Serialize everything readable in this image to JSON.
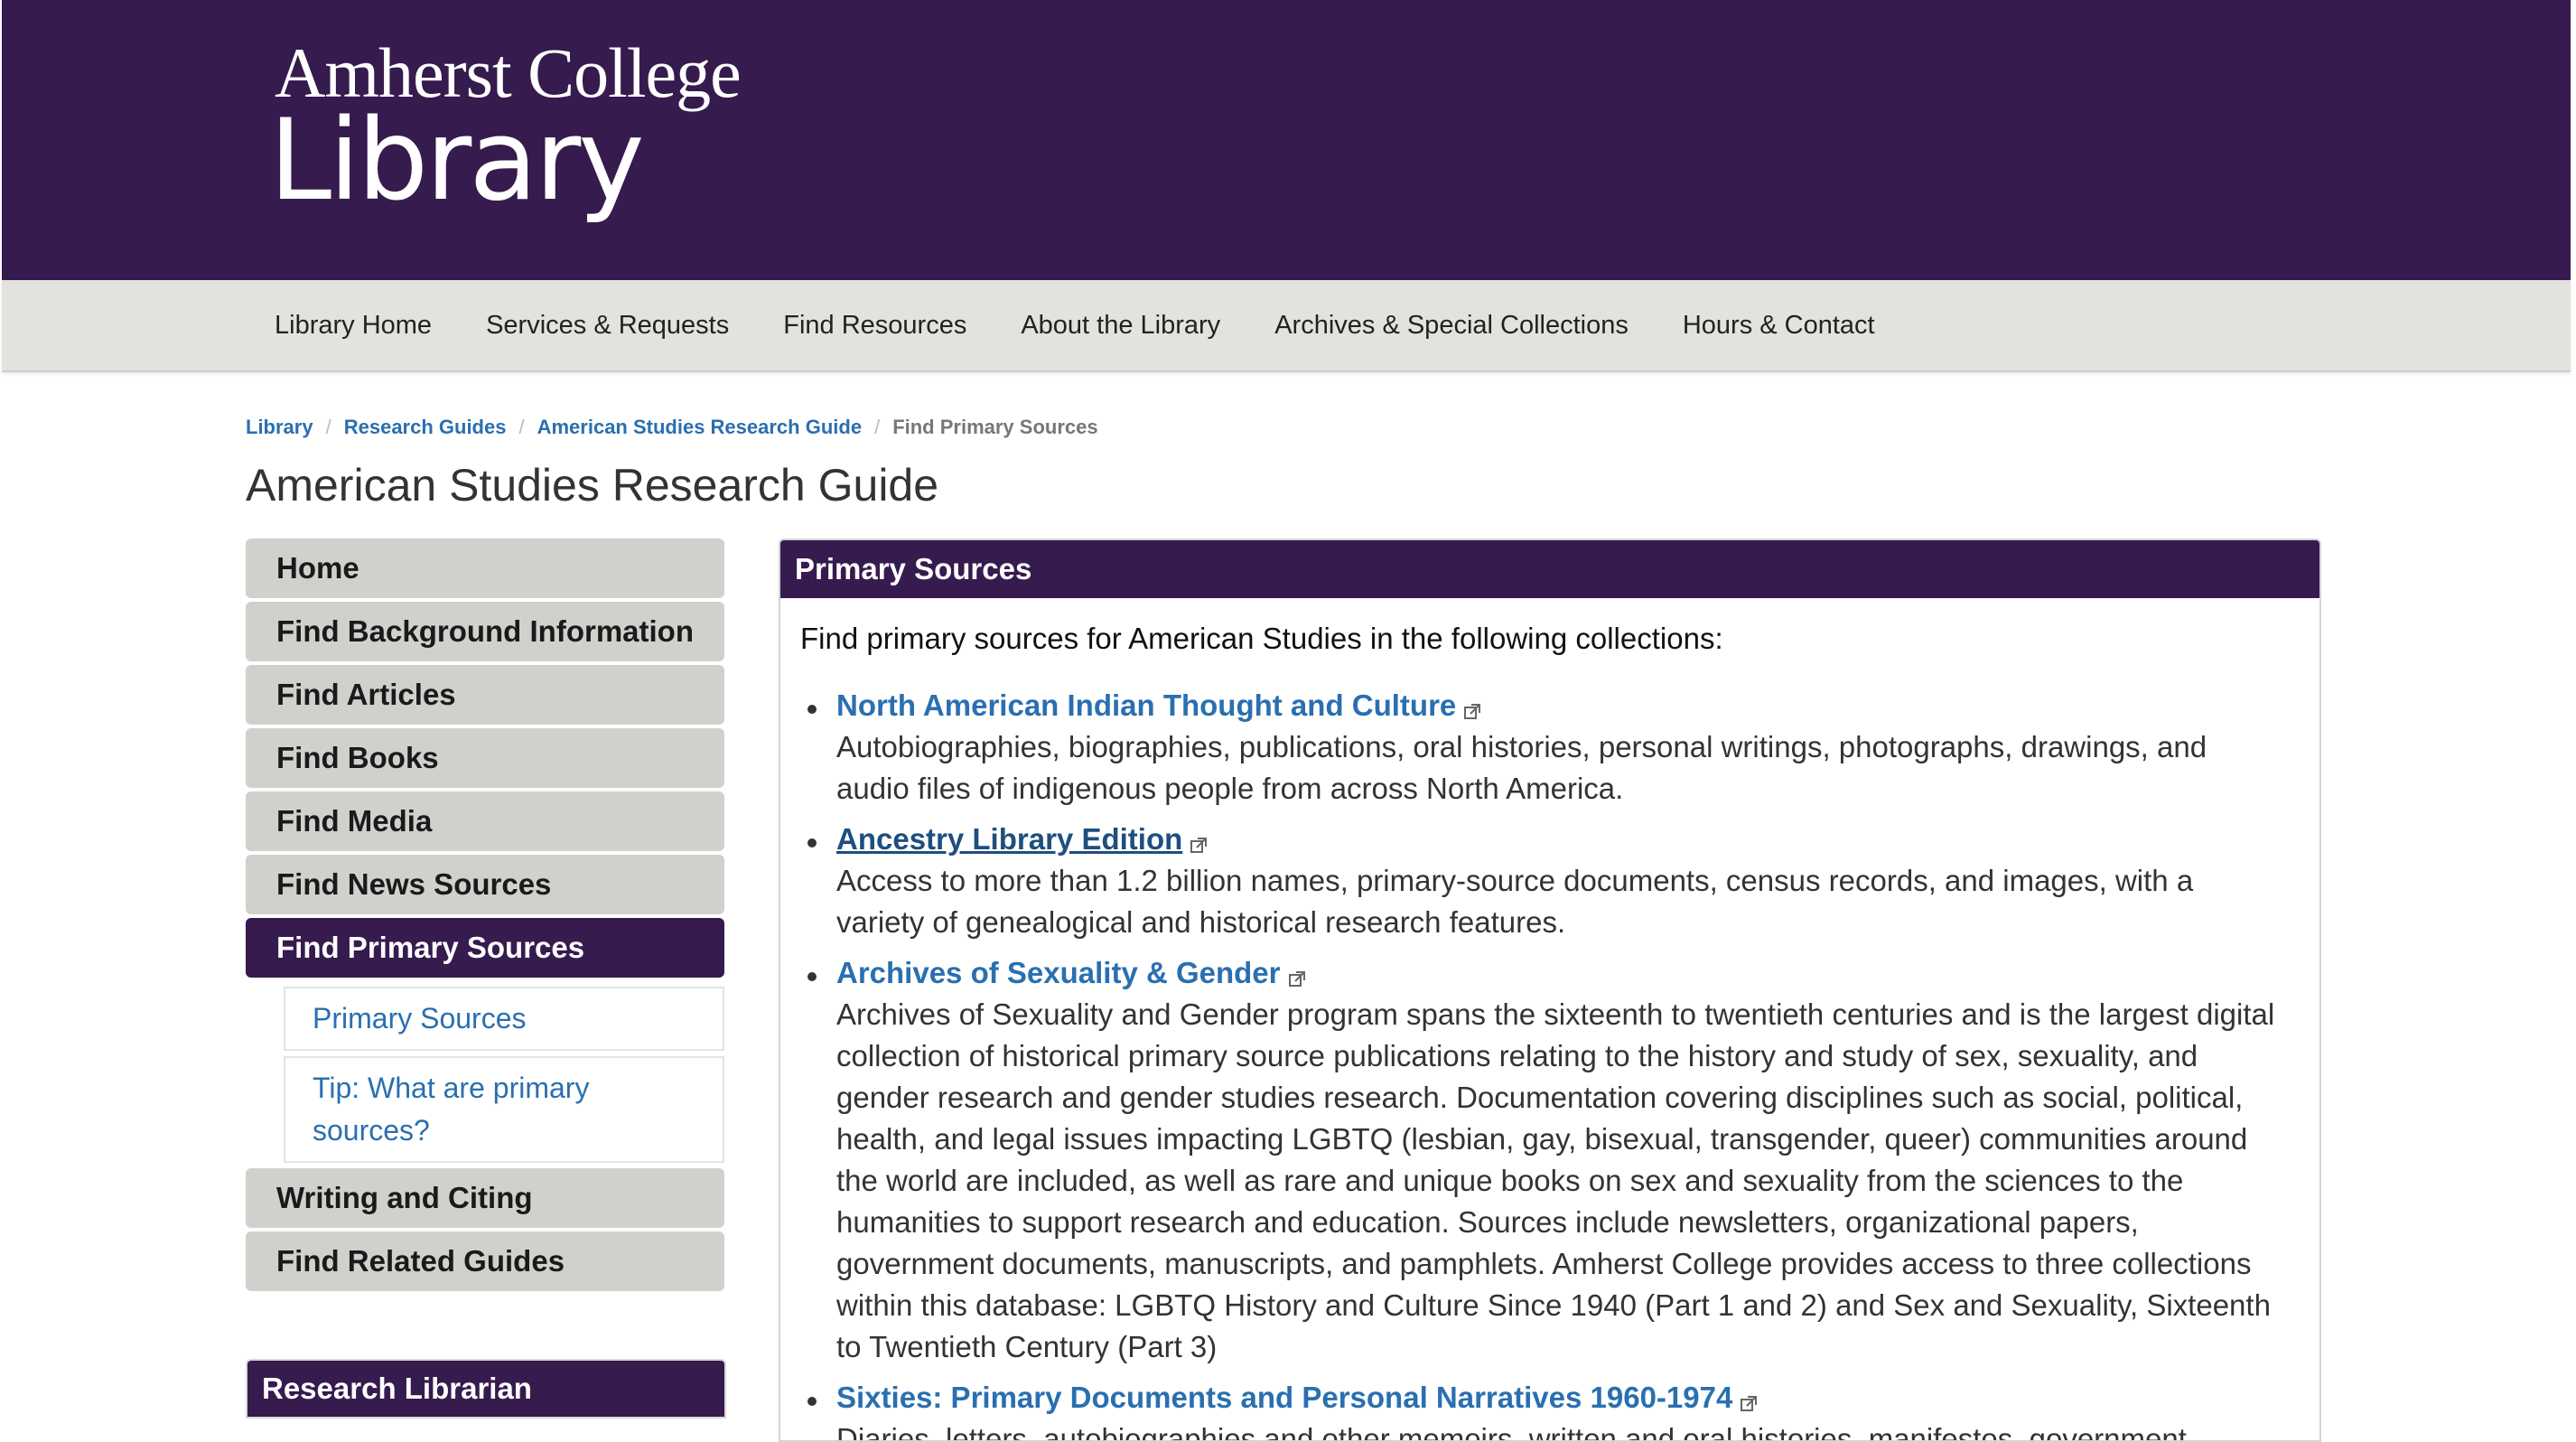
{
  "header": {
    "logo_line1": "Amherst College",
    "logo_line2": "Library"
  },
  "nav": {
    "items": [
      {
        "label": "Library Home"
      },
      {
        "label": "Services & Requests"
      },
      {
        "label": "Find Resources"
      },
      {
        "label": "About the Library"
      },
      {
        "label": "Archives & Special Collections"
      },
      {
        "label": "Hours & Contact"
      }
    ]
  },
  "breadcrumb": {
    "items": [
      {
        "label": "Library"
      },
      {
        "label": "Research Guides"
      },
      {
        "label": "American Studies Research Guide"
      }
    ],
    "current": "Find Primary Sources"
  },
  "page": {
    "title": "American Studies Research Guide"
  },
  "sidebar": {
    "items": [
      {
        "label": "Home"
      },
      {
        "label": "Find Background Information"
      },
      {
        "label": "Find Articles"
      },
      {
        "label": "Find Books"
      },
      {
        "label": "Find Media"
      },
      {
        "label": "Find News Sources"
      },
      {
        "label": "Find Primary Sources"
      },
      {
        "label": "Writing and Citing"
      },
      {
        "label": "Find Related Guides"
      }
    ],
    "subitems": [
      {
        "label": "Primary Sources"
      },
      {
        "label": "Tip: What are primary sources?"
      }
    ],
    "librarian_title": "Research Librarian"
  },
  "main": {
    "panel_title": "Primary Sources",
    "intro": "Find primary sources for American Studies in the following collections:",
    "resources": [
      {
        "title": "North American Indian Thought and Culture",
        "description": "Autobiographies, biographies, publications, oral histories, personal writings, photographs, drawings, and audio files of indigenous people from across North America."
      },
      {
        "title": "Ancestry Library Edition",
        "description": "Access to more than 1.2 billion names, primary-source documents, census records, and images, with a variety of genealogical and historical research features."
      },
      {
        "title": "Archives of Sexuality & Gender",
        "description": "Archives of Sexuality and Gender program spans the sixteenth to twentieth centuries and is the largest digital collection of historical primary source publications relating to the history and study of sex, sexuality, and gender research and gender studies research. Documentation covering disciplines such as social, political, health, and legal issues impacting LGBTQ (lesbian, gay, bisexual, transgender, queer) communities around the world are included, as well as rare and unique books on sex and sexuality from the sciences to the humanities to support research and education. Sources include newsletters, organizational papers, government documents, manuscripts, and pamphlets. Amherst College provides access to three collections within this database: LGBTQ History and Culture Since 1940 (Part 1 and 2) and Sex and Sexuality, Sixteenth to Twentieth Century (Part 3)"
      },
      {
        "title": "Sixties: Primary Documents and Personal Narratives 1960-1974",
        "description": "Diaries, letters, autobiographies and other memoirs, written and oral histories, manifestos, government"
      }
    ]
  },
  "colors": {
    "brand_purple": "#361b4e",
    "nav_gray": "#e3e2de",
    "link_blue": "#2a6fb0"
  }
}
